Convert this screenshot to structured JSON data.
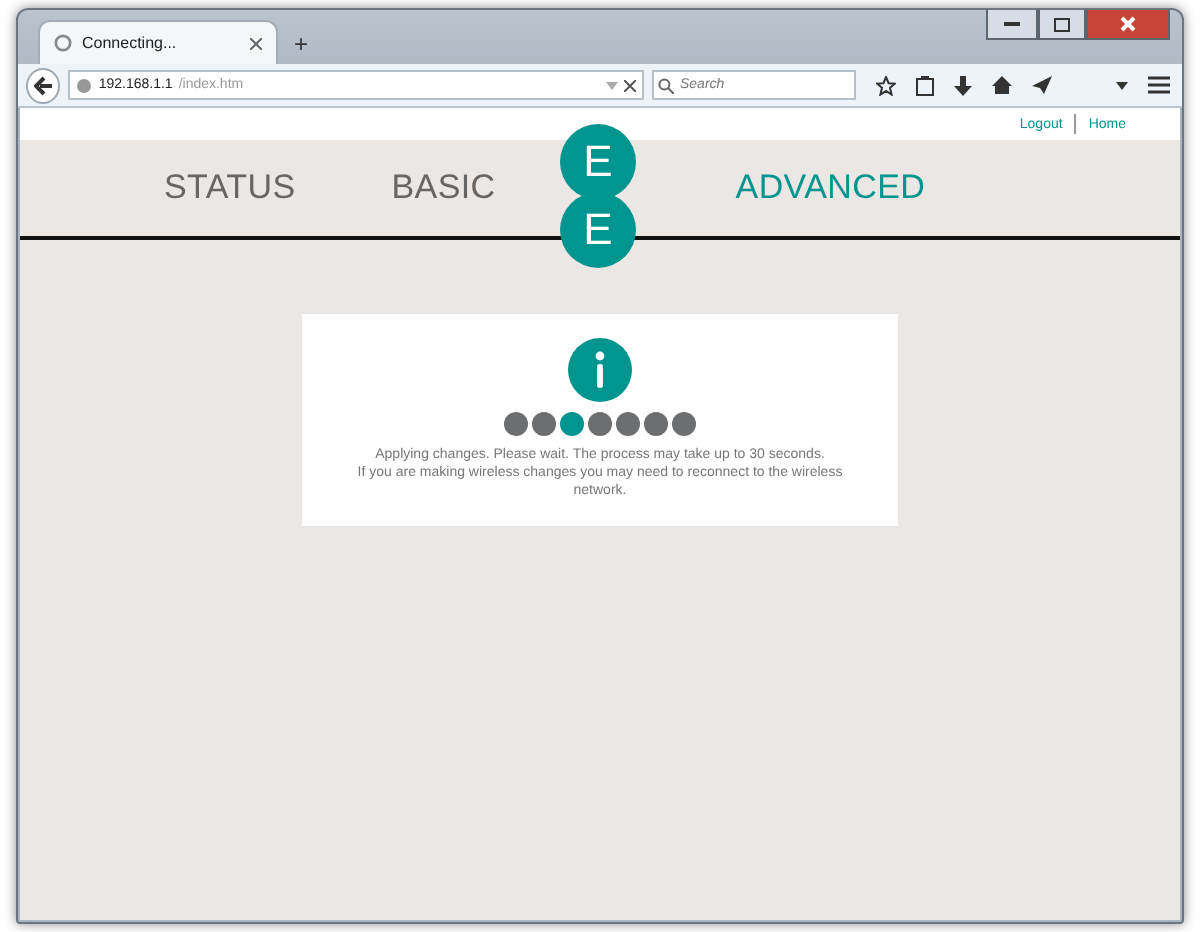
{
  "browser": {
    "tab": {
      "title": "Connecting..."
    },
    "new_tab": "+",
    "address": {
      "host": "192.168.1.1",
      "path": "/index.htm"
    },
    "search": {
      "placeholder": "Search"
    }
  },
  "header": {
    "links": [
      {
        "label": "Logout"
      },
      {
        "label": "Home"
      }
    ],
    "nav": [
      {
        "label": "STATUS",
        "selected": false
      },
      {
        "label": "BASIC",
        "selected": false
      },
      {
        "label": "ADVANCED",
        "selected": true
      }
    ],
    "logo": [
      "E",
      "E"
    ]
  },
  "dialog": {
    "progress": [
      {
        "selected": false
      },
      {
        "selected": false
      },
      {
        "selected": true
      },
      {
        "selected": false
      },
      {
        "selected": false
      },
      {
        "selected": false
      },
      {
        "selected": false
      }
    ],
    "message": "Applying changes. Please wait. The process may take up to 30 seconds.",
    "note": "If you are making wireless changes you may need to reconnect to the wireless network."
  }
}
